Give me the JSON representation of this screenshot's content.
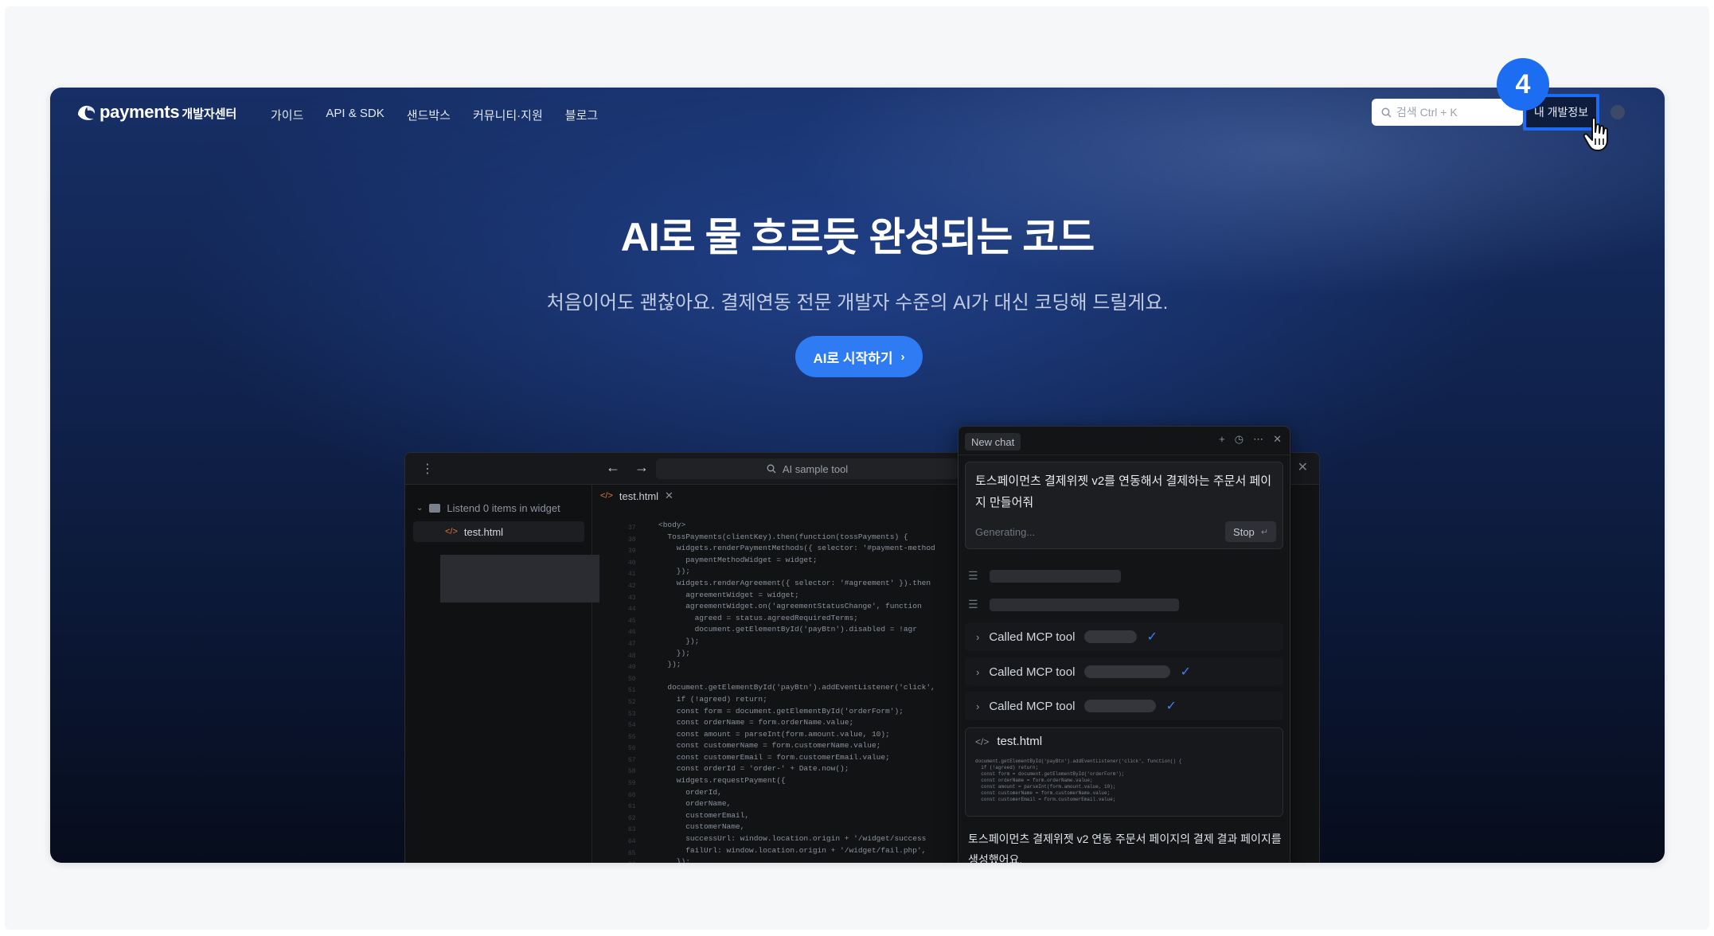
{
  "nav": {
    "brand": "payments",
    "brand_suffix": "개발자센터",
    "links": [
      "가이드",
      "API & SDK",
      "샌드박스",
      "커뮤니티·지원",
      "블로그"
    ],
    "search_placeholder": "검색 Ctrl + K",
    "my_dev_info": "내 개발정보"
  },
  "overlay": {
    "step_number": "4"
  },
  "hero": {
    "title": "AI로 물 흐르듯 완성되는 코드",
    "subtitle": "처음이어도 괜찮아요. 결제연동 전문 개발자 수준의 AI가 대신 코딩해 드릴게요.",
    "cta_label": "AI로 시작하기"
  },
  "editor": {
    "search_label": "AI sample tool",
    "tree_root": "Listend 0 items in widget",
    "file": "test.html",
    "tab": "test.html",
    "code_lines": [
      "<body>",
      "  TossPayments(clientKey).then(function(tossPayments) {",
      "    widgets.renderPaymentMethods({ selector: '#payment-method",
      "      paymentMethodWidget = widget;",
      "    });",
      "    widgets.renderAgreement({ selector: '#agreement' }).then",
      "      agreementWidget = widget;",
      "      agreementWidget.on('agreementStatusChange', function",
      "        agreed = status.agreedRequiredTerms;",
      "        document.getElementById('payBtn').disabled = !agr",
      "      });",
      "    });",
      "  });",
      "",
      "  document.getElementById('payBtn').addEventListener('click',",
      "    if (!agreed) return;",
      "    const form = document.getElementById('orderForm');",
      "    const orderName = form.orderName.value;",
      "    const amount = parseInt(form.amount.value, 10);",
      "    const customerName = form.customerName.value;",
      "    const customerEmail = form.customerEmail.value;",
      "    const orderId = 'order-' + Date.now();",
      "    widgets.requestPayment({",
      "      orderId,",
      "      orderName,",
      "      customerEmail,",
      "      customerName,",
      "      successUrl: window.location.origin + '/widget/success",
      "      failUrl: window.location.origin + '/widget/fail.php',",
      "    });"
    ]
  },
  "chat": {
    "tab": "New chat",
    "prompt": "토스페이먼츠 결제위젯 v2를 연동해서 결제하는 주문서 페이지 만들어줘",
    "status": "Generating...",
    "stop_label": "Stop",
    "tool_calls": [
      "Called MCP tool",
      "Called MCP tool",
      "Called MCP tool"
    ],
    "file_name": "test.html",
    "file_code": [
      "document.getElementById('payBtn').addEventListener('click', function() {",
      "  if (!agreed) return;",
      "  const form = document.getElementById('orderForm');",
      "  const orderName = form.orderName.value;",
      "  const amount = parseInt(form.amount.value, 10);",
      "  const customerName = form.customerName.value;",
      "  const customerEmail = form.customerEmail.value;"
    ],
    "result": "토스페이먼츠 결제위젯 v2 연동 주문서 페이지의 결제 결과 페이지를 생성했어요."
  },
  "colors": {
    "accent": "#2f7bf3",
    "highlight_border": "#1d6bf5",
    "check": "#3b82f6"
  }
}
